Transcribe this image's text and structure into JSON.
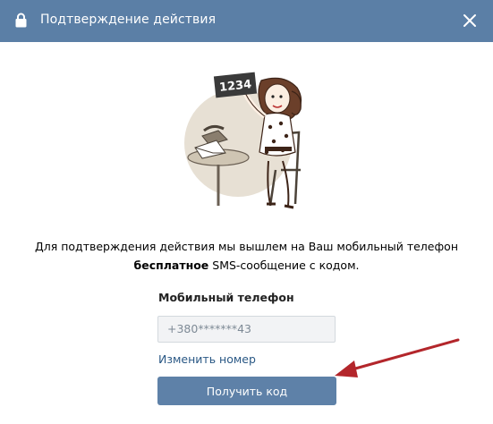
{
  "dialog": {
    "title": "Подтверждение действия",
    "header_color": "#5b7fa6"
  },
  "icons": {
    "lock": "lock-icon",
    "close": "close-icon"
  },
  "illustration": {
    "code_sign": "1234"
  },
  "message": {
    "part1": "Для подтверждения действия мы вышлем на Ваш мобильный телефон",
    "bold": "бесплатное",
    "part2": " SMS-сообщение с кодом."
  },
  "phone": {
    "label": "Мобильный телефон",
    "value": "+380*******43"
  },
  "change_link": "Изменить номер",
  "submit_label": "Получить код",
  "colors": {
    "button": "#5e81a8",
    "link": "#2a5885",
    "arrow": "#b3262b"
  }
}
